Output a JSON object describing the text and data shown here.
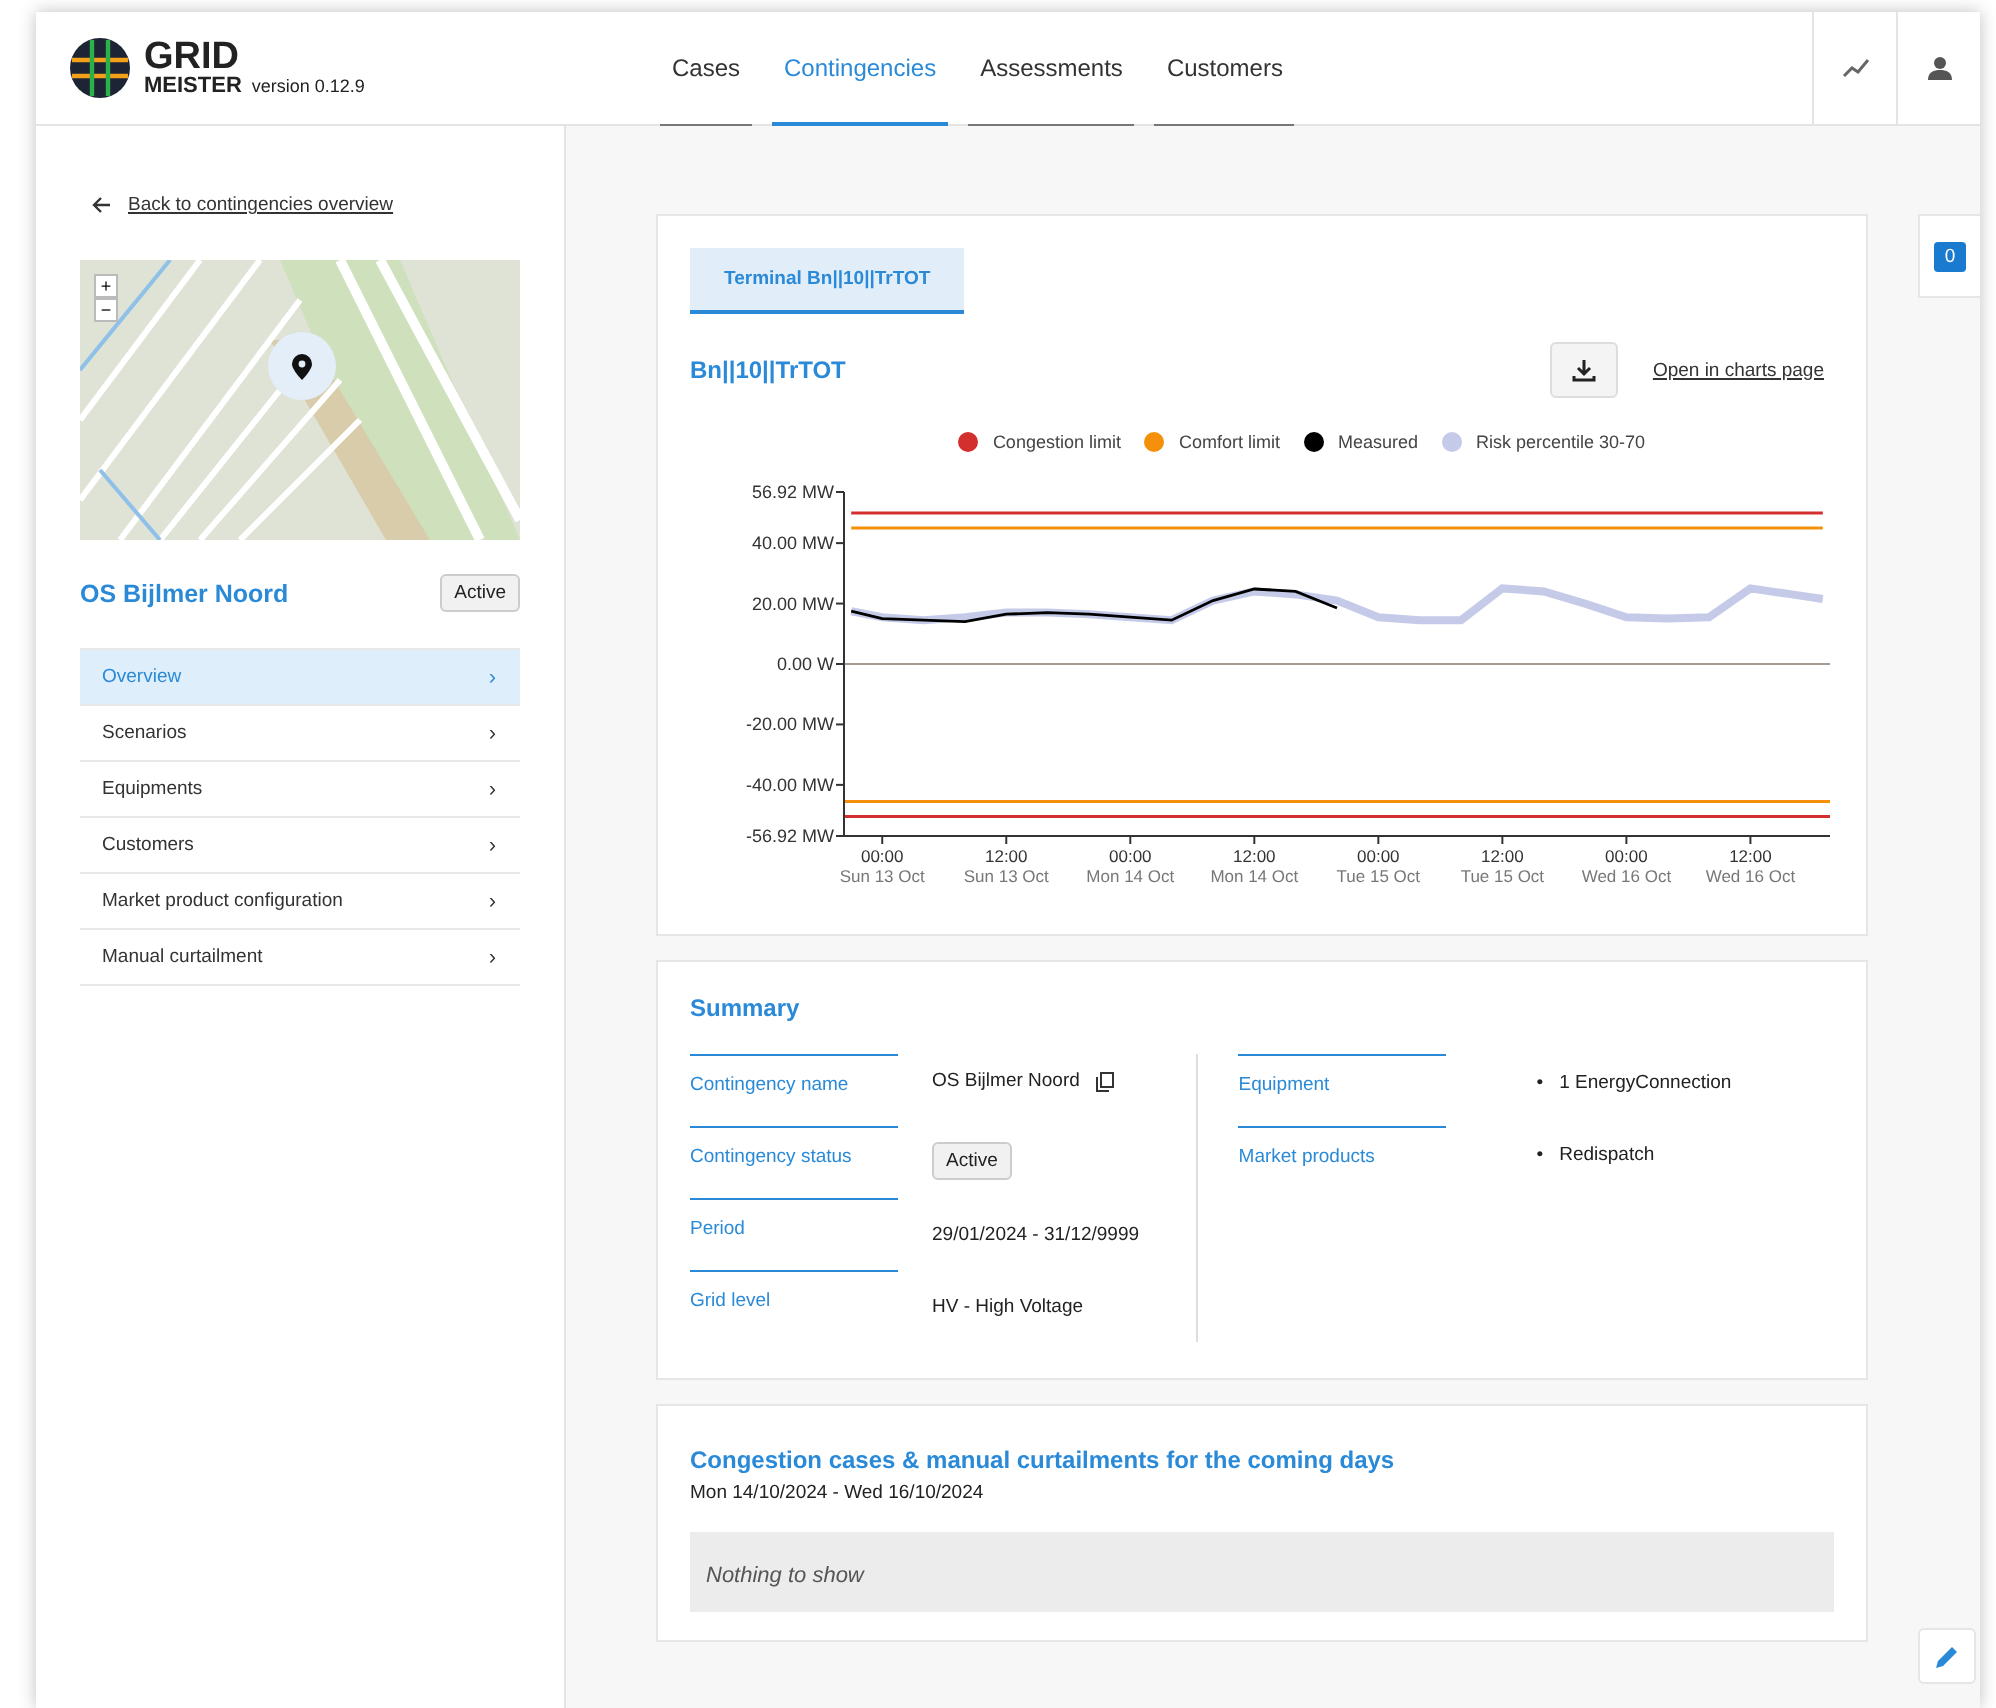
{
  "header": {
    "logo_top": "GRID",
    "logo_bottom": "MEISTER",
    "version": "version 0.12.9",
    "nav": [
      {
        "label": "Cases",
        "selected": false
      },
      {
        "label": "Contingencies",
        "selected": true
      },
      {
        "label": "Assessments",
        "selected": false
      },
      {
        "label": "Customers",
        "selected": false
      }
    ]
  },
  "sidebar": {
    "back_link": "Back to contingencies overview",
    "map_zoom": [
      "+",
      "−"
    ],
    "title": "OS Bijlmer Noord",
    "status": "Active",
    "menu": [
      {
        "label": "Overview",
        "chevron": "›",
        "selected": true
      },
      {
        "label": "Scenarios",
        "chevron": "›",
        "selected": false
      },
      {
        "label": "Equipments",
        "chevron": "›",
        "selected": false
      },
      {
        "label": "Customers",
        "chevron": "›",
        "selected": false
      },
      {
        "label": "Market product configuration",
        "chevron": "›",
        "selected": false
      },
      {
        "label": "Manual curtailment",
        "chevron": "›",
        "selected": false
      }
    ]
  },
  "chart_card": {
    "tabs": [
      {
        "label": "Terminal Bn||10||TrTOT",
        "selected": true
      }
    ],
    "title": "Bn||10||TrTOT",
    "link": "Open in charts page",
    "chart_data": {
      "type": "line",
      "x": [
        "2024-10-12T21:00",
        "2024-10-13T00:00",
        "2024-10-13T04:00",
        "2024-10-13T08:00",
        "2024-10-13T12:00",
        "2024-10-13T16:00",
        "2024-10-13T20:00",
        "2024-10-14T00:00",
        "2024-10-14T04:00",
        "2024-10-14T08:00",
        "2024-10-14T12:00",
        "2024-10-14T16:00",
        "2024-10-14T20:00",
        "2024-10-15T00:00",
        "2024-10-15T04:00",
        "2024-10-15T08:00",
        "2024-10-15T12:00",
        "2024-10-15T16:00",
        "2024-10-15T20:00",
        "2024-10-16T00:00",
        "2024-10-16T04:00",
        "2024-10-16T08:00",
        "2024-10-16T12:00",
        "2024-10-16T16:00",
        "2024-10-16T19:00"
      ],
      "xlim": [
        "2024-10-12T20:18",
        "2024-10-16T19:42"
      ],
      "ylim": [
        -56.92,
        56.92
      ],
      "xticks": [
        {
          "value": "2024-10-13T00:00",
          "label": "00:00 Sun 13 Oct"
        },
        {
          "value": "2024-10-13T12:00",
          "label": "12:00 Sun 13 Oct"
        },
        {
          "value": "2024-10-14T00:00",
          "label": "00:00 Mon 14 Oct"
        },
        {
          "value": "2024-10-14T12:00",
          "label": "12:00 Mon 14 Oct"
        },
        {
          "value": "2024-10-15T00:00",
          "label": "00:00 Tue 15 Oct"
        },
        {
          "value": "2024-10-15T12:00",
          "label": "12:00 Tue 15 Oct"
        },
        {
          "value": "2024-10-16T00:00",
          "label": "00:00 Wed 16 Oct"
        },
        {
          "value": "2024-10-16T12:00",
          "label": "12:00 Wed 16 Oct"
        }
      ],
      "yticks": [
        {
          "value": 56.92,
          "label": "56.92 MW"
        },
        {
          "value": 40,
          "label": "40.00 MW"
        },
        {
          "value": 20,
          "label": "20.00 MW"
        },
        {
          "value": 0,
          "label": "0.00 W"
        },
        {
          "value": -20,
          "label": "-20.00 MW"
        },
        {
          "value": -40,
          "label": "-40.00 MW"
        },
        {
          "value": -56.92,
          "label": "-56.92 MW"
        }
      ],
      "series": [
        {
          "name": "Congestion limit",
          "color": "#d32f2f",
          "values": [
            50,
            50,
            50,
            50,
            50,
            50,
            50,
            50,
            50,
            50,
            50,
            50,
            50,
            50,
            50,
            50,
            50,
            50,
            50,
            50,
            50,
            50,
            50,
            50,
            50
          ]
        },
        {
          "name": "Comfort limit",
          "color": "#f5900a",
          "values": [
            45,
            45,
            45,
            45,
            45,
            45,
            45,
            45,
            45,
            45,
            45,
            45,
            45,
            45,
            45,
            45,
            45,
            45,
            45,
            45,
            45,
            45,
            45,
            45,
            45
          ]
        },
        {
          "name": "Measured",
          "color": "#000000",
          "values": [
            17.5,
            15,
            14.5,
            14,
            16.5,
            17,
            16.5,
            15.5,
            14.5,
            21,
            24.8,
            24,
            18.5,
            null,
            null,
            null,
            null,
            null,
            null,
            null,
            null,
            null,
            null,
            null,
            null
          ]
        },
        {
          "name": "Risk percentile 30-70",
          "color": "#c5cae9",
          "values": [
            17.5,
            15.5,
            14.5,
            15.5,
            17,
            17,
            16.5,
            15.5,
            14.5,
            21,
            24,
            23,
            21,
            15.5,
            14.5,
            14.5,
            25,
            24,
            20,
            15.5,
            15,
            15.5,
            25,
            23,
            21.5
          ]
        }
      ],
      "ref_lines": [
        {
          "axis": "y",
          "value": -50.5,
          "color": "#d32f2f"
        },
        {
          "axis": "y",
          "value": -45.5,
          "color": "#f5900a"
        }
      ]
    }
  },
  "summary": {
    "title": "Summary",
    "left": [
      {
        "label": "Contingency name",
        "kind": "copy",
        "value": "OS Bijlmer Noord"
      },
      {
        "label": "Contingency status",
        "kind": "badge",
        "value": "Active"
      },
      {
        "label": "Period",
        "kind": "text",
        "value": "29/01/2024 - 31/12/9999"
      },
      {
        "label": "Grid level",
        "kind": "text",
        "value": "HV - High Voltage"
      }
    ],
    "right": [
      {
        "label": "Equipment",
        "items": [
          {
            "bullet": "•",
            "text": "1 EnergyConnection"
          }
        ]
      },
      {
        "label": "Market products",
        "items": [
          {
            "bullet": "•",
            "text": "Redispatch"
          }
        ]
      }
    ]
  },
  "cases": {
    "title": "Congestion cases & manual curtailments for the coming days",
    "range": "Mon 14/10/2024 - Wed 16/10/2024",
    "empty": "Nothing to show"
  },
  "side_badge": "0"
}
